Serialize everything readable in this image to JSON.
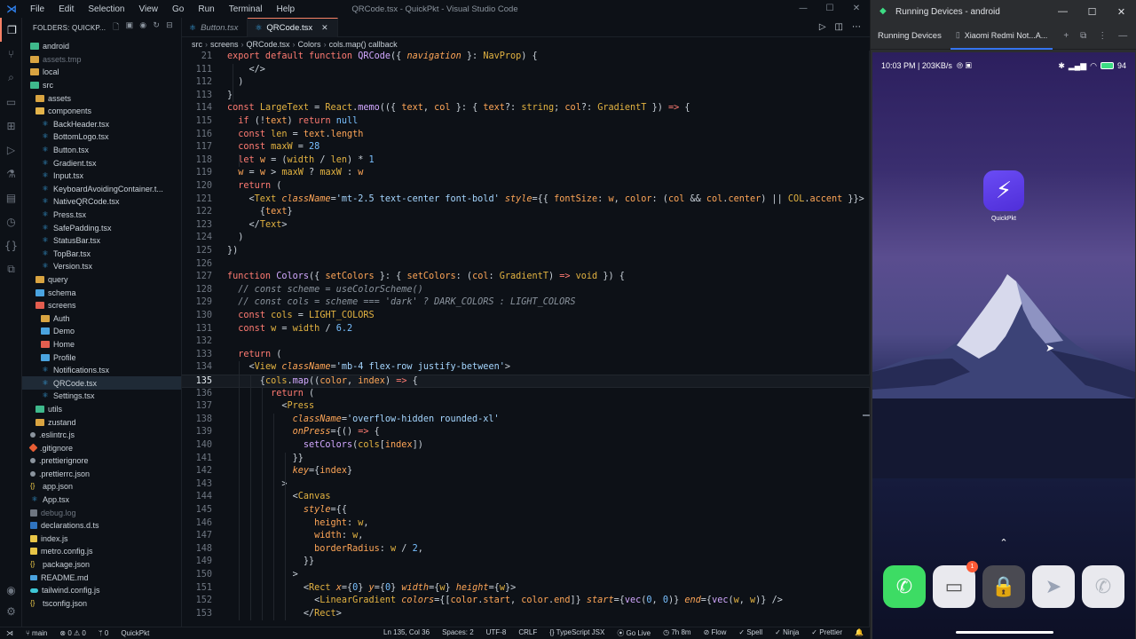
{
  "vscode": {
    "menu": [
      "File",
      "Edit",
      "Selection",
      "View",
      "Go",
      "Run",
      "Terminal",
      "Help"
    ],
    "window_title": "QRCode.tsx - QuickPkt - Visual Studio Code",
    "explorer_title": "FOLDERS: QUICKP...",
    "tree": [
      {
        "label": "android",
        "icon": "folder-green",
        "depth": 1
      },
      {
        "label": "assets.tmp",
        "icon": "folder",
        "depth": 1,
        "dim": true
      },
      {
        "label": "local",
        "icon": "folder",
        "depth": 1
      },
      {
        "label": "src",
        "icon": "folder-green",
        "depth": 1
      },
      {
        "label": "assets",
        "icon": "folder",
        "depth": 2
      },
      {
        "label": "components",
        "icon": "folder-open",
        "depth": 2
      },
      {
        "label": "BackHeader.tsx",
        "icon": "tsx",
        "depth": 3
      },
      {
        "label": "BottomLogo.tsx",
        "icon": "tsx",
        "depth": 3
      },
      {
        "label": "Button.tsx",
        "icon": "tsx",
        "depth": 3
      },
      {
        "label": "Gradient.tsx",
        "icon": "tsx",
        "depth": 3
      },
      {
        "label": "Input.tsx",
        "icon": "tsx",
        "depth": 3
      },
      {
        "label": "KeyboardAvoidingContainer.t...",
        "icon": "tsx",
        "depth": 3
      },
      {
        "label": "NativeQRCode.tsx",
        "icon": "tsx",
        "depth": 3
      },
      {
        "label": "Press.tsx",
        "icon": "tsx",
        "depth": 3
      },
      {
        "label": "SafePadding.tsx",
        "icon": "tsx",
        "depth": 3
      },
      {
        "label": "StatusBar.tsx",
        "icon": "tsx",
        "depth": 3
      },
      {
        "label": "TopBar.tsx",
        "icon": "tsx",
        "depth": 3
      },
      {
        "label": "Version.tsx",
        "icon": "tsx",
        "depth": 3
      },
      {
        "label": "query",
        "icon": "folder",
        "depth": 2
      },
      {
        "label": "schema",
        "icon": "folder-blue",
        "depth": 2
      },
      {
        "label": "screens",
        "icon": "folder-red",
        "depth": 2
      },
      {
        "label": "Auth",
        "icon": "folder",
        "depth": 3
      },
      {
        "label": "Demo",
        "icon": "folder-blue",
        "depth": 3
      },
      {
        "label": "Home",
        "icon": "folder-red",
        "depth": 3
      },
      {
        "label": "Profile",
        "icon": "folder-blue",
        "depth": 3
      },
      {
        "label": "Notifications.tsx",
        "icon": "tsx",
        "depth": 3
      },
      {
        "label": "QRCode.tsx",
        "icon": "tsx",
        "depth": 3,
        "selected": true
      },
      {
        "label": "Settings.tsx",
        "icon": "tsx",
        "depth": 3
      },
      {
        "label": "utils",
        "icon": "folder-green",
        "depth": 2
      },
      {
        "label": "zustand",
        "icon": "folder",
        "depth": 2
      },
      {
        "label": ".eslintrc.js",
        "icon": "dot",
        "depth": 1
      },
      {
        "label": ".gitignore",
        "icon": "git",
        "depth": 1
      },
      {
        "label": ".prettierignore",
        "icon": "dot",
        "depth": 1
      },
      {
        "label": ".prettierrc.json",
        "icon": "dot",
        "depth": 1
      },
      {
        "label": "app.json",
        "icon": "json",
        "depth": 1
      },
      {
        "label": "App.tsx",
        "icon": "tsx",
        "depth": 1
      },
      {
        "label": "debug.log",
        "icon": "log",
        "depth": 1,
        "dim": true
      },
      {
        "label": "declarations.d.ts",
        "icon": "ts",
        "depth": 1
      },
      {
        "label": "index.js",
        "icon": "js",
        "depth": 1
      },
      {
        "label": "metro.config.js",
        "icon": "js",
        "depth": 1
      },
      {
        "label": "package.json",
        "icon": "json",
        "depth": 1
      },
      {
        "label": "README.md",
        "icon": "md",
        "depth": 1
      },
      {
        "label": "tailwind.config.js",
        "icon": "tw",
        "depth": 1
      },
      {
        "label": "tsconfig.json",
        "icon": "json",
        "depth": 1
      }
    ],
    "tabs": [
      {
        "label": "Button.tsx",
        "active": false
      },
      {
        "label": "QRCode.tsx",
        "active": true
      }
    ],
    "breadcrumb": [
      "src",
      "screens",
      "QRCode.tsx",
      "Colors",
      "cols.map() callback"
    ],
    "code": [
      {
        "n": "21",
        "html": "<span class=\"k\">export default function</span> <span class=\"f\">QRCode</span>({ <span class=\"v it\">navigation</span> }: <span class=\"y\">NavProp</span>) {"
      },
      {
        "n": "111",
        "html": "    &lt;/&gt;"
      },
      {
        "n": "112",
        "html": "  )"
      },
      {
        "n": "113",
        "html": "}"
      },
      {
        "n": "114",
        "html": "<span class=\"k\">const</span> <span class=\"y\">LargeText</span> = <span class=\"y\">React</span>.<span class=\"f\">memo</span>(({ <span class=\"v\">text</span>, <span class=\"v\">col</span> }: { <span class=\"v\">text</span>?: <span class=\"y\">string</span>; <span class=\"v\">col</span>?: <span class=\"y\">GradientT</span> }) <span class=\"k\">=&gt;</span> {"
      },
      {
        "n": "115",
        "html": "  <span class=\"k\">if</span> (!<span class=\"v\">text</span>) <span class=\"k\">return</span> <span class=\"p\">null</span>"
      },
      {
        "n": "116",
        "html": "  <span class=\"k\">const</span> <span class=\"y\">len</span> = <span class=\"v\">text</span>.<span class=\"v\">length</span>"
      },
      {
        "n": "117",
        "html": "  <span class=\"k\">const</span> <span class=\"y\">maxW</span> = <span class=\"p\">28</span>"
      },
      {
        "n": "118",
        "html": "  <span class=\"k\">let</span> <span class=\"v\">w</span> = (<span class=\"y\">width</span> / <span class=\"y\">len</span>) * <span class=\"p\">1</span>"
      },
      {
        "n": "119",
        "html": "  <span class=\"v\">w</span> = <span class=\"v\">w</span> &gt; <span class=\"y\">maxW</span> ? <span class=\"y\">maxW</span> : <span class=\"v\">w</span>"
      },
      {
        "n": "120",
        "html": "  <span class=\"k\">return</span> ("
      },
      {
        "n": "121",
        "html": "    &lt;<span class=\"y\">Text</span> <span class=\"v it\">className</span>=<span class=\"s\">'mt-2.5 text-center font-bold'</span> <span class=\"v it\">style</span>={{ <span class=\"v\">fontSize</span>: <span class=\"v\">w</span>, <span class=\"v\">color</span>: (<span class=\"v\">col</span> &amp;&amp; <span class=\"v\">col</span>.<span class=\"v\">center</span>) || <span class=\"y\">COL</span>.<span class=\"v\">accent</span> }}&gt;"
      },
      {
        "n": "122",
        "html": "      {<span class=\"v\">text</span>}"
      },
      {
        "n": "123",
        "html": "    &lt;/<span class=\"y\">Text</span>&gt;"
      },
      {
        "n": "124",
        "html": "  )"
      },
      {
        "n": "125",
        "html": "})"
      },
      {
        "n": "126",
        "html": ""
      },
      {
        "n": "127",
        "html": "<span class=\"k\">function</span> <span class=\"f\">Colors</span>({ <span class=\"v\">setColors</span> }: { <span class=\"v\">setColors</span>: (<span class=\"v\">col</span>: <span class=\"y\">GradientT</span>) <span class=\"k\">=&gt;</span> <span class=\"y\">void</span> }) {"
      },
      {
        "n": "128",
        "html": "  <span class=\"c\">// const scheme = useColorScheme()</span>"
      },
      {
        "n": "129",
        "html": "  <span class=\"c\">// const cols = scheme === 'dark' ? DARK_COLORS : LIGHT_COLORS</span>"
      },
      {
        "n": "130",
        "html": "  <span class=\"k\">const</span> <span class=\"y\">cols</span> = <span class=\"y\">LIGHT_COLORS</span>"
      },
      {
        "n": "131",
        "html": "  <span class=\"k\">const</span> <span class=\"y\">w</span> = <span class=\"y\">width</span> / <span class=\"p\">6.2</span>"
      },
      {
        "n": "132",
        "html": ""
      },
      {
        "n": "133",
        "html": "  <span class=\"k\">return</span> ("
      },
      {
        "n": "134",
        "html": "    &lt;<span class=\"y\">View</span> <span class=\"v it\">className</span>=<span class=\"s\">'mb-4 flex-row justify-between'</span>&gt;"
      },
      {
        "n": "135",
        "html": "      {<span class=\"y\">cols</span>.<span class=\"f\">map</span>((<span class=\"v\">color</span>, <span class=\"v\">index</span>) <span class=\"k\">=&gt;</span> {",
        "current": true
      },
      {
        "n": "136",
        "html": "        <span class=\"k\">return</span> ("
      },
      {
        "n": "137",
        "html": "          &lt;<span class=\"y\">Press</span>"
      },
      {
        "n": "138",
        "html": "            <span class=\"v it\">className</span>=<span class=\"s\">'overflow-hidden rounded-xl'</span>"
      },
      {
        "n": "139",
        "html": "            <span class=\"v it\">onPress</span>={() <span class=\"k\">=&gt;</span> {"
      },
      {
        "n": "140",
        "html": "              <span class=\"f\">setColors</span>(<span class=\"y\">cols</span>[<span class=\"v\">index</span>])"
      },
      {
        "n": "141",
        "html": "            }}"
      },
      {
        "n": "142",
        "html": "            <span class=\"v it\">key</span>={<span class=\"v\">index</span>}"
      },
      {
        "n": "143",
        "html": "          &gt;"
      },
      {
        "n": "144",
        "html": "            &lt;<span class=\"y\">Canvas</span>"
      },
      {
        "n": "145",
        "html": "              <span class=\"v it\">style</span>={{"
      },
      {
        "n": "146",
        "html": "                <span class=\"v\">height</span>: <span class=\"y\">w</span>,"
      },
      {
        "n": "147",
        "html": "                <span class=\"v\">width</span>: <span class=\"y\">w</span>,"
      },
      {
        "n": "148",
        "html": "                <span class=\"v\">borderRadius</span>: <span class=\"y\">w</span> / <span class=\"p\">2</span>,"
      },
      {
        "n": "149",
        "html": "              }}"
      },
      {
        "n": "150",
        "html": "            &gt;"
      },
      {
        "n": "151",
        "html": "              &lt;<span class=\"y\">Rect</span> <span class=\"v it\">x</span>={<span class=\"p\">0</span>} <span class=\"v it\">y</span>={<span class=\"p\">0</span>} <span class=\"v it\">width</span>={<span class=\"y\">w</span>} <span class=\"v it\">height</span>={<span class=\"y\">w</span>}&gt;"
      },
      {
        "n": "152",
        "html": "                &lt;<span class=\"y\">LinearGradient</span> <span class=\"v it\">colors</span>={[<span class=\"v\">color</span>.<span class=\"v\">start</span>, <span class=\"v\">color</span>.<span class=\"v\">end</span>]} <span class=\"v it\">start</span>={<span class=\"f\">vec</span>(<span class=\"p\">0</span>, <span class=\"p\">0</span>)} <span class=\"v it\">end</span>={<span class=\"f\">vec</span>(<span class=\"y\">w</span>, <span class=\"y\">w</span>)} /&gt;"
      },
      {
        "n": "153",
        "html": "              &lt;/<span class=\"y\">Rect</span>&gt;"
      }
    ],
    "status": {
      "branch": "main",
      "errors": "0",
      "warnings": "0",
      "ports": "0",
      "project": "QuickPkt",
      "position": "Ln 135, Col 36",
      "spaces": "Spaces: 2",
      "encoding": "UTF-8",
      "eol": "CRLF",
      "language": "{} TypeScript JSX",
      "golive": "Go Live",
      "time": "7h 8m",
      "flow": "Flow",
      "spell": "Spell",
      "ninja": "Ninja",
      "prettier": "Prettier"
    }
  },
  "devices": {
    "window_title": "Running Devices - android",
    "panel_label": "Running Devices",
    "device_tab": "Xiaomi Redmi Not...A...",
    "phone": {
      "time": "10:03 PM | 203KB/s",
      "battery": "94",
      "app_name": "QuickPkt",
      "message_badge": "1"
    }
  }
}
